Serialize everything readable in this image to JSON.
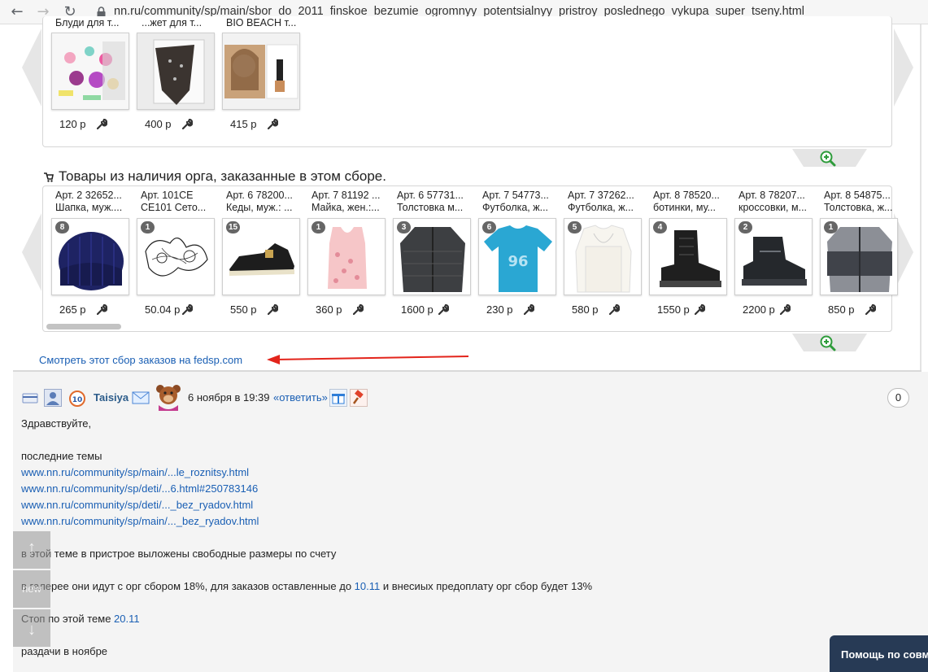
{
  "browser": {
    "back": "←",
    "forward": "→",
    "reload": "↻",
    "url": "nn.ru/community/sp/main/sbor_do_2011_finskoe_bezumie_ogromnyy_potentsialnyy_pristroy_poslednego_vykupa_super_tseny.html"
  },
  "top_gallery": {
    "captions": [
      "Блуди для т...",
      "...жет для т...",
      "BIO BEACH т..."
    ],
    "prices": [
      "120 р",
      "400 р",
      "415 р"
    ]
  },
  "section": {
    "title": "Товары из наличия орга, заказанные в этом сборе."
  },
  "products": [
    {
      "art": "Арт. 2 32652...",
      "name": "Шапка, муж....",
      "qty": "8",
      "price": "265 р"
    },
    {
      "art": "Арт. 101CE",
      "name": "CE101 Сето...",
      "qty": "1",
      "price": "50.04 р"
    },
    {
      "art": "Арт. 6 78200...",
      "name": "Кеды, муж.: ...",
      "qty": "15",
      "price": "550 р"
    },
    {
      "art": "Арт. 7 81192 ...",
      "name": "Майка, жен.:...",
      "qty": "1",
      "price": "360 р"
    },
    {
      "art": "Арт. 6 57731...",
      "name": "Толстовка м...",
      "qty": "3",
      "price": "1600 р"
    },
    {
      "art": "Арт. 7 54773...",
      "name": "Футболка, ж...",
      "qty": "6",
      "price": "230 р"
    },
    {
      "art": "Арт. 7 37262...",
      "name": "Футболка, ж...",
      "qty": "5",
      "price": "580 р"
    },
    {
      "art": "Арт. 8 78520...",
      "name": "ботинки, му...",
      "qty": "4",
      "price": "1550 р"
    },
    {
      "art": "Арт. 8 78207...",
      "name": "кроссовки, м...",
      "qty": "2",
      "price": "2200 р"
    },
    {
      "art": "Арт. 8 54875...",
      "name": "Толстовка, ж...",
      "qty": "1",
      "price": "850 р"
    }
  ],
  "fedsp_link": "Смотреть этот сбор заказов на fedsp.com",
  "comment": {
    "author": "Taisiya",
    "date": "6 ноября в 19:39",
    "reply": "«ответить»",
    "counter": "0",
    "greeting": "Здравствуйте,",
    "topics_label": "последние темы",
    "links": [
      "www.nn.ru/community/sp/main/...le_roznitsy.html",
      "www.nn.ru/community/sp/deti/...6.html#250783146",
      "www.nn.ru/community/sp/deti/..._bez_ryadov.html",
      "www.nn.ru/community/sp/main/..._bez_ryadov.html"
    ],
    "p1": "в этой теме в пристрое выложены свободные размеры по счету",
    "p2_before": "в галерее они идут с орг сбором 18%, для заказов оставленные до ",
    "p2_date": "10.11",
    "p2_after": " и внесиых предоплату орг сбор будет 13%",
    "p3_before": "Стоп по этой теме ",
    "p3_date": "20.11",
    "p4": "раздачи в ноябре"
  },
  "scroll_buttons": {
    "up": "↑",
    "new": "new",
    "down": "↓"
  },
  "help_button": "Помощь по совм"
}
